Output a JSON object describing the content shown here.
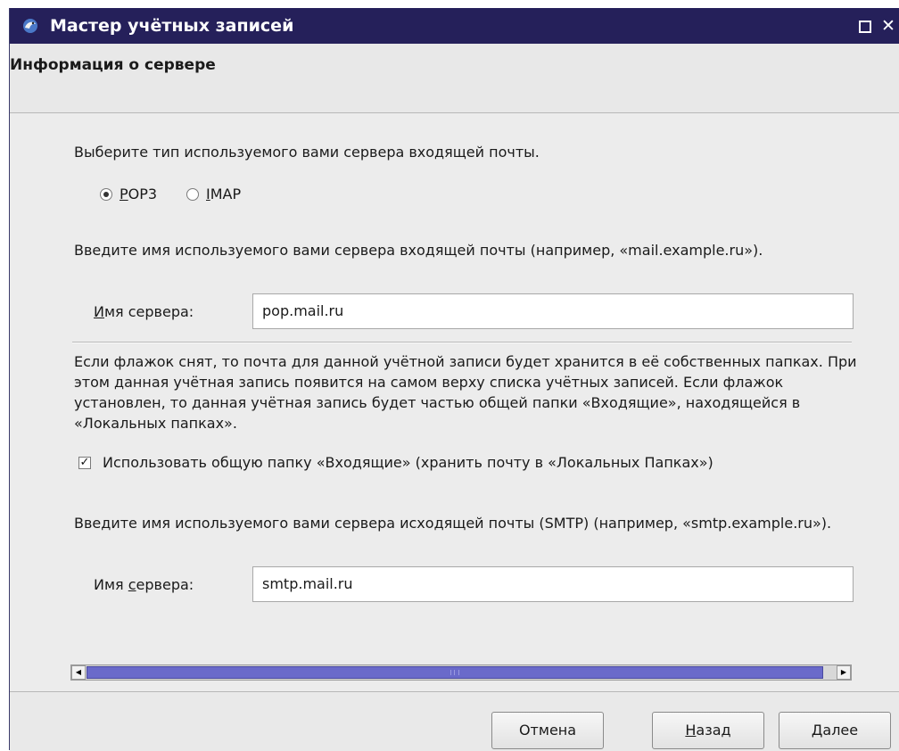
{
  "window": {
    "title": "Мастер учётных записей",
    "maximize_icon": "maximize-icon",
    "close_icon": "close-icon",
    "close_glyph": "✕"
  },
  "header": {
    "title": "Информация о сервере"
  },
  "incoming": {
    "type_prompt": "Выберите тип используемого вами сервера входящей почты.",
    "radio_options": [
      {
        "label_access": "P",
        "label_rest": "OP3",
        "checked": true
      },
      {
        "label_access": "I",
        "label_rest": "MAP",
        "checked": false
      }
    ],
    "server_prompt": "Введите имя используемого вами сервера входящей почты (например, «mail.example.ru»).",
    "server_label_access": "И",
    "server_label_rest": "мя сервера:",
    "server_value": "pop.mail.ru"
  },
  "inbox": {
    "description": "Если флажок снят, то почта для данной учётной записи будет хранится в её собственных папках. При этом данная учётная запись появится на самом верху списка учётных записей. Если флажок установлен, то данная учётная запись будет частью общей папки «Входящие», находящейся в «Локальных папках».",
    "checkbox_label": "Использовать общую папку «Входящие» (хранить почту в «Локальных Папках»)",
    "checkbox_checked": true,
    "check_glyph": "✓"
  },
  "outgoing": {
    "server_prompt": "Введите имя используемого вами сервера исходящей почты (SMTP) (например, «smtp.example.ru»).",
    "server_label_before": "Имя ",
    "server_label_access": "с",
    "server_label_after": "ервера:",
    "server_value": "smtp.mail.ru"
  },
  "scrollbar": {
    "left_arrow": "◀",
    "right_arrow": "▶"
  },
  "buttons": {
    "cancel": "Отмена",
    "back_access": "Н",
    "back_rest": "азад",
    "next_access": "Д",
    "next_rest": "алее"
  }
}
